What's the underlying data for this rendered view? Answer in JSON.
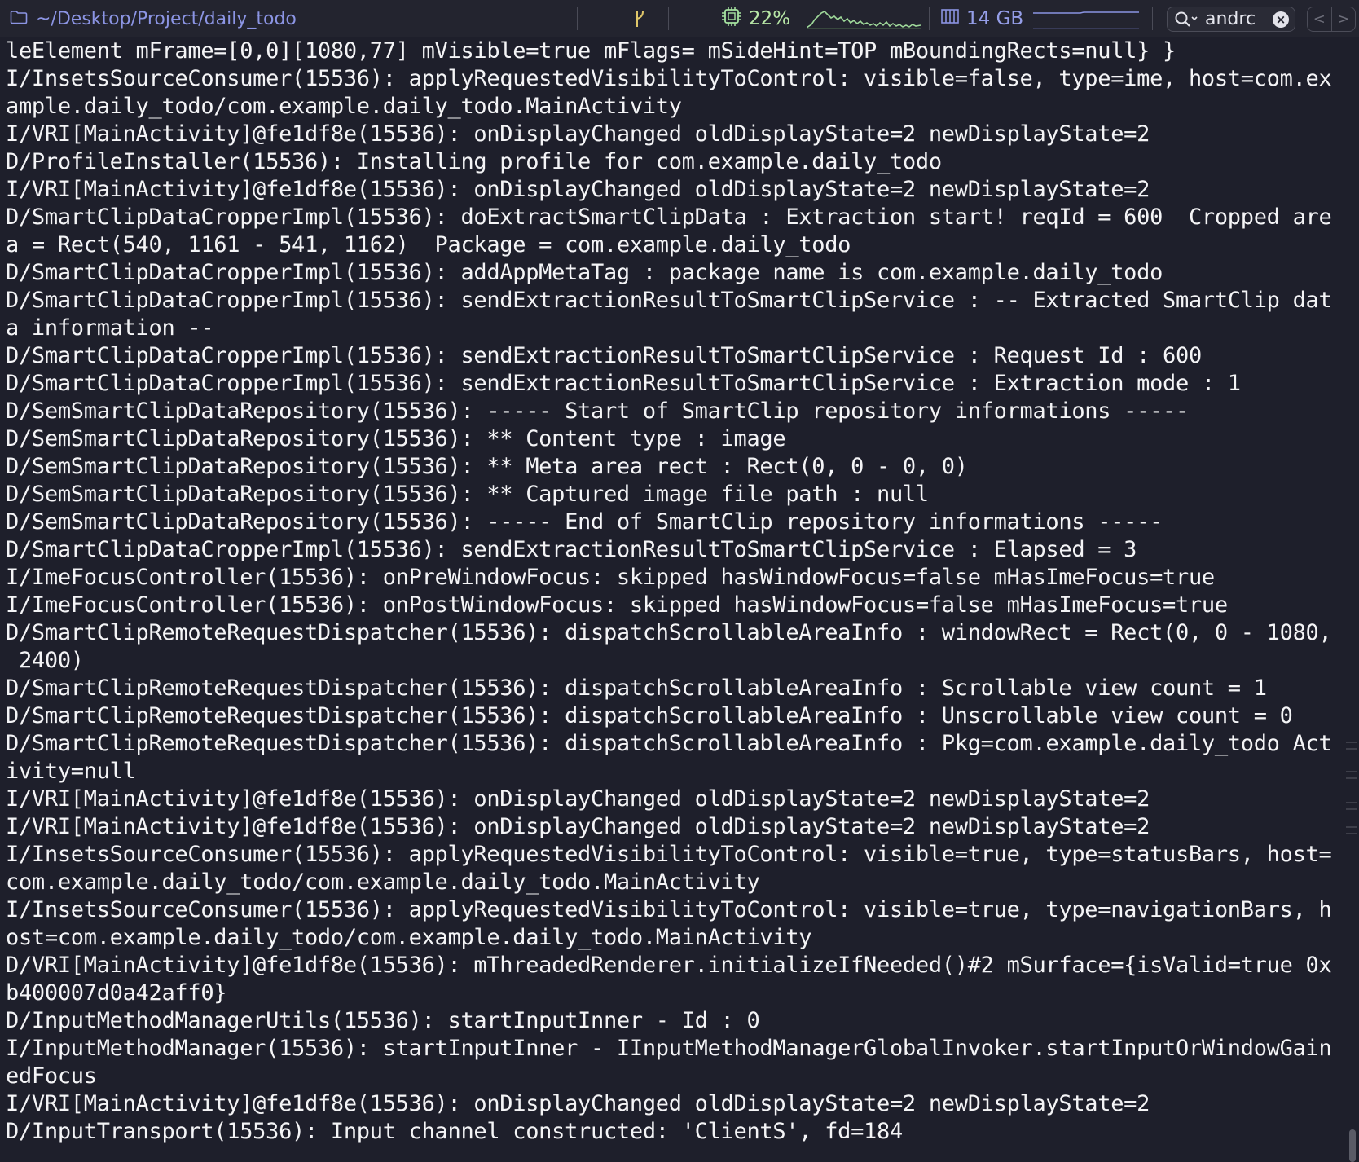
{
  "statusbar": {
    "path": "~/Desktop/Project/daily_todo",
    "cpu": "22%",
    "memory": "14 GB",
    "search_value": "andrc",
    "folder_icon": "folder-icon",
    "git_icon": "git-branch-icon",
    "cpu_icon": "cpu-chip-icon",
    "memory_icon": "memory-icon",
    "search_icon": "search-icon",
    "clear_icon": "clear-icon",
    "nav_prev": "<",
    "nav_next": ">",
    "colors": {
      "path": "#8c95e4",
      "cpu": "#a6e3a1",
      "memory": "#959ee8",
      "background": "#1e1f2b"
    }
  },
  "log": {
    "lines": [
      "leElement mFrame=[0,0][1080,77] mVisible=true mFlags= mSideHint=TOP mBoundingRects=null} }",
      "I/InsetsSourceConsumer(15536): applyRequestedVisibilityToControl: visible=false, type=ime, host=com.ex",
      "ample.daily_todo/com.example.daily_todo.MainActivity",
      "I/VRI[MainActivity]@fe1df8e(15536): onDisplayChanged oldDisplayState=2 newDisplayState=2",
      "D/ProfileInstaller(15536): Installing profile for com.example.daily_todo",
      "I/VRI[MainActivity]@fe1df8e(15536): onDisplayChanged oldDisplayState=2 newDisplayState=2",
      "D/SmartClipDataCropperImpl(15536): doExtractSmartClipData : Extraction start! reqId = 600  Cropped are",
      "a = Rect(540, 1161 - 541, 1162)  Package = com.example.daily_todo",
      "D/SmartClipDataCropperImpl(15536): addAppMetaTag : package name is com.example.daily_todo",
      "D/SmartClipDataCropperImpl(15536): sendExtractionResultToSmartClipService : -- Extracted SmartClip dat",
      "a information --",
      "D/SmartClipDataCropperImpl(15536): sendExtractionResultToSmartClipService : Request Id : 600",
      "D/SmartClipDataCropperImpl(15536): sendExtractionResultToSmartClipService : Extraction mode : 1",
      "D/SemSmartClipDataRepository(15536): ----- Start of SmartClip repository informations -----",
      "D/SemSmartClipDataRepository(15536): ** Content type : image",
      "D/SemSmartClipDataRepository(15536): ** Meta area rect : Rect(0, 0 - 0, 0)",
      "D/SemSmartClipDataRepository(15536): ** Captured image file path : null",
      "D/SemSmartClipDataRepository(15536): ----- End of SmartClip repository informations -----",
      "D/SmartClipDataCropperImpl(15536): sendExtractionResultToSmartClipService : Elapsed = 3",
      "I/ImeFocusController(15536): onPreWindowFocus: skipped hasWindowFocus=false mHasImeFocus=true",
      "I/ImeFocusController(15536): onPostWindowFocus: skipped hasWindowFocus=false mHasImeFocus=true",
      "D/SmartClipRemoteRequestDispatcher(15536): dispatchScrollableAreaInfo : windowRect = Rect(0, 0 - 1080,",
      " 2400)",
      "D/SmartClipRemoteRequestDispatcher(15536): dispatchScrollableAreaInfo : Scrollable view count = 1",
      "D/SmartClipRemoteRequestDispatcher(15536): dispatchScrollableAreaInfo : Unscrollable view count = 0",
      "D/SmartClipRemoteRequestDispatcher(15536): dispatchScrollableAreaInfo : Pkg=com.example.daily_todo Act",
      "ivity=null",
      "I/VRI[MainActivity]@fe1df8e(15536): onDisplayChanged oldDisplayState=2 newDisplayState=2",
      "I/VRI[MainActivity]@fe1df8e(15536): onDisplayChanged oldDisplayState=2 newDisplayState=2",
      "I/InsetsSourceConsumer(15536): applyRequestedVisibilityToControl: visible=true, type=statusBars, host=",
      "com.example.daily_todo/com.example.daily_todo.MainActivity",
      "I/InsetsSourceConsumer(15536): applyRequestedVisibilityToControl: visible=true, type=navigationBars, h",
      "ost=com.example.daily_todo/com.example.daily_todo.MainActivity",
      "D/VRI[MainActivity]@fe1df8e(15536): mThreadedRenderer.initializeIfNeeded()#2 mSurface={isValid=true 0x",
      "b400007d0a42aff0}",
      "D/InputMethodManagerUtils(15536): startInputInner - Id : 0",
      "I/InputMethodManager(15536): startInputInner - IInputMethodManagerGlobalInvoker.startInputOrWindowGain",
      "edFocus",
      "I/VRI[MainActivity]@fe1df8e(15536): onDisplayChanged oldDisplayState=2 newDisplayState=2",
      "D/InputTransport(15536): Input channel constructed: 'ClientS', fd=184"
    ]
  }
}
